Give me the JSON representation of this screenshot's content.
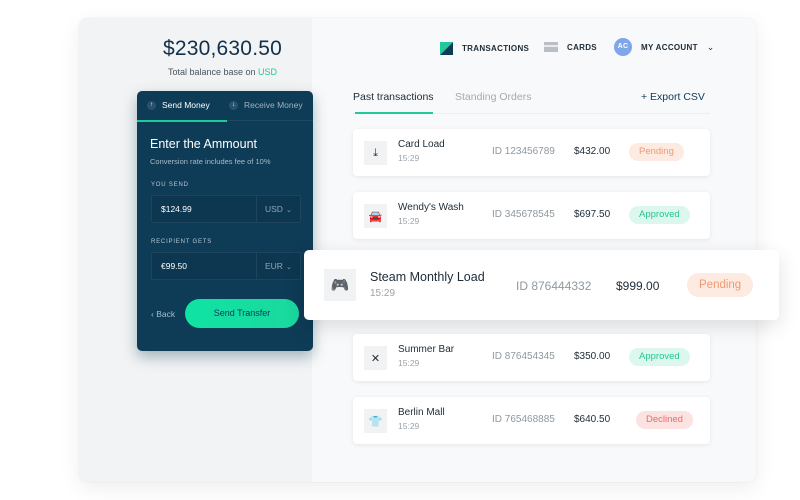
{
  "balance": {
    "amount": "$230,630.50",
    "caption_prefix": "Total balance base on ",
    "caption_currency": "USD"
  },
  "transfer_card": {
    "tabs": [
      {
        "label": "Send Money",
        "icon": "arrow-up-icon",
        "active": true
      },
      {
        "label": "Receive Money",
        "icon": "arrow-down-icon",
        "active": false
      }
    ],
    "title": "Enter the Ammount",
    "subtitle": "Conversion rate includes fee of 10%",
    "you_send": {
      "label": "YOU SEND",
      "value": "$124.99",
      "currency": "USD"
    },
    "recipient_gets": {
      "label": "RECIPIENT GETS",
      "value": "€99.50",
      "currency": "EUR"
    },
    "back_label": "Back",
    "send_label": "Send Transfer"
  },
  "nav": {
    "transactions": "TRANSACTIONS",
    "cards": "CARDS",
    "avatar_initials": "AC",
    "account": "MY ACCOUNT"
  },
  "tx_tabs": {
    "past": "Past transactions",
    "standing": "Standing Orders",
    "export": "+ Export CSV"
  },
  "transactions": [
    {
      "name": "Card Load",
      "time": "15:29",
      "id": "ID 123456789",
      "amount": "$432.00",
      "status": "Pending",
      "icon": "download-icon"
    },
    {
      "name": "Wendy's Wash",
      "time": "15:29",
      "id": "ID 345678545",
      "amount": "$697.50",
      "status": "Approved",
      "icon": "car-wash-icon"
    },
    {
      "name": "Steam Monthly Load",
      "time": "15:29",
      "id": "ID 876444332",
      "amount": "$999.00",
      "status": "Pending",
      "icon": "gamepad-icon"
    },
    {
      "name": "Summer Bar",
      "time": "15:29",
      "id": "ID 876454345",
      "amount": "$350.00",
      "status": "Approved",
      "icon": "utensils-icon"
    },
    {
      "name": "Berlin Mall",
      "time": "15:29",
      "id": "ID 765468885",
      "amount": "$640.50",
      "status": "Declined",
      "icon": "shirt-icon"
    }
  ],
  "colors": {
    "accent": "#21c99a",
    "navy": "#0e3b56",
    "pending": "#ef9a74",
    "approved": "#27c592",
    "declined": "#ec6a6a"
  }
}
